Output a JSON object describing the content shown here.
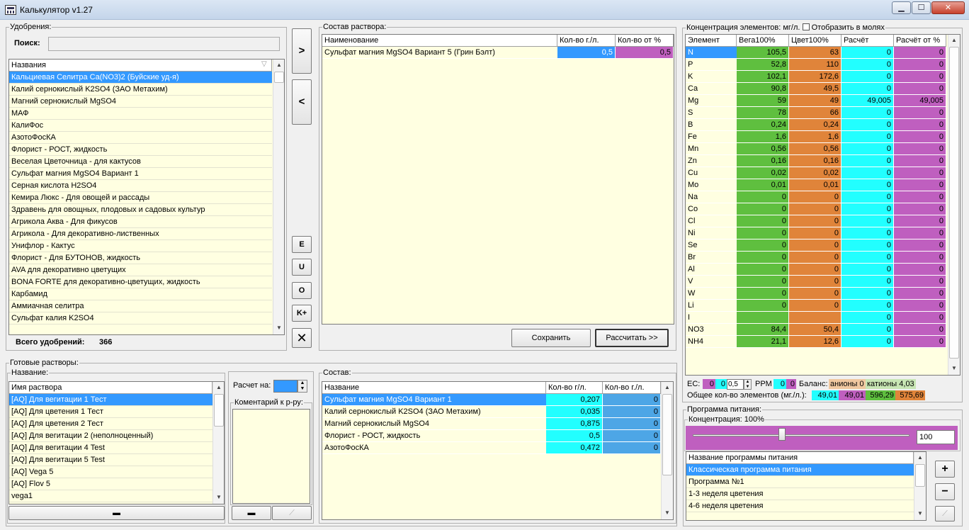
{
  "window": {
    "title": "Калькулятор v1.27",
    "min": "▁",
    "max": "☐",
    "close": "✕"
  },
  "fert": {
    "legend": "Удобрения:",
    "search_label": "Поиск:",
    "search_value": "",
    "col": "Названия",
    "total_label": "Всего удобрений:",
    "total": "366",
    "items": [
      "Кальциевая Селитра Ca(NO3)2 (Буйские уд-я)",
      "Калий  сернокислый  K2SO4 (ЗАО Метахим)",
      "Магний сернокислый MgSO4",
      "МАФ",
      "КалиФос",
      "АзотоФосКА",
      "Флорист - РОСТ, жидкость",
      "Веселая Цветочница - для кактусов",
      "Сульфат магния MgSO4 Вариант 1",
      "Серная кислота H2SO4",
      "Кемира Люкс - Для овощей и рассады",
      "Здравень для овощных, плодовых и садовых культур",
      "Агрикола Аква - Для фикусов",
      "Агрикола - Для декоративно-лиственных",
      "Унифлор - Кактус",
      "Флорист - Для БУТОНОВ, жидкость",
      "AVA для декоративно цветущих",
      "BONA FORTE для декоративно-цветущих, жидкость",
      "Карбамид",
      "Аммиачная селитра",
      "Сульфат калия K2SO4"
    ]
  },
  "mid": {
    "add": ">",
    "remove": "<",
    "e": "E",
    "u": "U",
    "o": "O",
    "k": "K+",
    "x": "✕"
  },
  "solution": {
    "legend": "Состав раствора:",
    "col_name": "Наименование",
    "col_qty": "Кол-во г./л.",
    "col_pct": "Кол-во от %",
    "rows": [
      {
        "name": "Сульфат магния MgSO4 Вариант 5 (Грин Бэлт)",
        "qty": "0,5",
        "pct": "0,5"
      }
    ],
    "save": "Сохранить",
    "calc": "Рассчитать >>"
  },
  "conc": {
    "legend": "Концентрация элементов: мг/л.",
    "moles": "Отобразить в молях",
    "cols": [
      "Элемент",
      "Вега100%",
      "Цвет100%",
      "Расчёт",
      "Расчёт от %"
    ],
    "rows": [
      [
        "N",
        "105,5",
        "63",
        "0",
        "0"
      ],
      [
        "P",
        "52,8",
        "110",
        "0",
        "0"
      ],
      [
        "K",
        "102,1",
        "172,6",
        "0",
        "0"
      ],
      [
        "Ca",
        "90,8",
        "49,5",
        "0",
        "0"
      ],
      [
        "Mg",
        "59",
        "49",
        "49,005",
        "49,005"
      ],
      [
        "S",
        "78",
        "66",
        "0",
        "0"
      ],
      [
        "B",
        "0,24",
        "0,24",
        "0",
        "0"
      ],
      [
        "Fe",
        "1,6",
        "1,6",
        "0",
        "0"
      ],
      [
        "Mn",
        "0,56",
        "0,56",
        "0",
        "0"
      ],
      [
        "Zn",
        "0,16",
        "0,16",
        "0",
        "0"
      ],
      [
        "Cu",
        "0,02",
        "0,02",
        "0",
        "0"
      ],
      [
        "Mo",
        "0,01",
        "0,01",
        "0",
        "0"
      ],
      [
        "Na",
        "0",
        "0",
        "0",
        "0"
      ],
      [
        "Co",
        "0",
        "0",
        "0",
        "0"
      ],
      [
        "Cl",
        "0",
        "0",
        "0",
        "0"
      ],
      [
        "Ni",
        "0",
        "0",
        "0",
        "0"
      ],
      [
        "Se",
        "0",
        "0",
        "0",
        "0"
      ],
      [
        "Br",
        "0",
        "0",
        "0",
        "0"
      ],
      [
        "Al",
        "0",
        "0",
        "0",
        "0"
      ],
      [
        "V",
        "0",
        "0",
        "0",
        "0"
      ],
      [
        "W",
        "0",
        "0",
        "0",
        "0"
      ],
      [
        "Li",
        "0",
        "0",
        "0",
        "0"
      ],
      [
        "I",
        "",
        "",
        "0",
        "0"
      ],
      [
        "NO3",
        "84,4",
        "50,4",
        "0",
        "0"
      ],
      [
        "NH4",
        "21,1",
        "12,6",
        "0",
        "0"
      ]
    ],
    "ec_label": "EC:",
    "ec1": "0",
    "ec2": "0",
    "ec_in": "0,5",
    "ppm": "PPM",
    "ppm1": "0",
    "ppm2": "0",
    "balance": "Баланс:",
    "anions": "анионы 0",
    "cations": "катионы 4,03",
    "total_label": "Общее кол-во элементов (мг./л.):",
    "t1": "49,01",
    "t2": "49,01",
    "t3": "596,29",
    "t4": "575,69"
  },
  "ready": {
    "legend": "Готовые растворы:",
    "name_legend": "Название:",
    "col": "Имя раствора",
    "items": [
      "[AQ] Для вегитации 1 Тест",
      "[AQ] Для цветения 1 Тест",
      "[AQ] Для цветения 2 Тест",
      "[AQ] Для вегитации 2 (неполноценный)",
      "[AQ] Для вегитации 4 Test",
      "[AQ] Для вегитации 5 Test",
      "[AQ] Vega 5",
      "[AQ] Flov 5",
      "vega1"
    ],
    "minus": "▬",
    "calc_for": "Расчет на:",
    "comment": "Коментарий к р-ру:"
  },
  "comp": {
    "legend": "Состав:",
    "col_name": "Название",
    "col_q1": "Кол-во г/л.",
    "col_q2": "Кол-во г./л.",
    "rows": [
      [
        "Сульфат магния MgSO4 Вариант 1",
        "0,207",
        "0"
      ],
      [
        "Калий  сернокислый  K2SO4 (ЗАО Метахим)",
        "0,035",
        "0"
      ],
      [
        "Магний сернокислый MgSO4",
        "0,875",
        "0"
      ],
      [
        "Флорист - РОСТ, жидкость",
        "0,5",
        "0"
      ],
      [
        "АзотоФосКА",
        "0,472",
        "0"
      ]
    ]
  },
  "program": {
    "legend": "Программа питания:",
    "conc": "Концентрация: 100%",
    "value": "100",
    "level": 0.5,
    "col": "Название программы питания",
    "items": [
      "Классическая программа питания",
      "Программа №1",
      "1-3 неделя цветения",
      "4-6 неделя цветения"
    ],
    "plus": "+",
    "minus": "−"
  }
}
